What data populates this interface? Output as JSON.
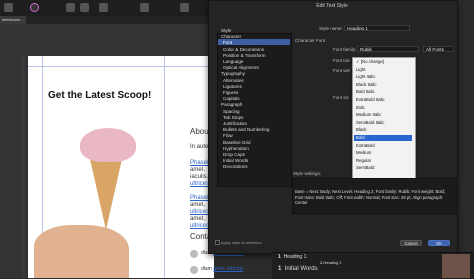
{
  "toolbar": {
    "tab_label": "eferences..."
  },
  "document": {
    "headline": "Get the Latest Scoop!",
    "about_label": "Abou",
    "body_lines": [
      "In aute",
      "Phasell",
      "amet,",
      "iaculis.",
      "ultrices,",
      "Phasell",
      "amet,",
      "ultrices,",
      "amet,",
      "ultrices,"
    ],
    "contacts_label": "Conta",
    "meta_1_prefix": "diam",
    "meta_1_link": "amet, lobortis",
    "meta_2_prefix": "diam",
    "meta_2_link": "amet, lobortis"
  },
  "dialog": {
    "title": "Edit Text Style",
    "style_label": "Style",
    "style_name_label": "Style name:",
    "style_name_value": "Heading 1",
    "character_font_label": "Character Font",
    "font_family_label": "Font family:",
    "font_family_value": "Rubik",
    "font_filter_value": "All Fonts",
    "font_traits_label": "Font trai",
    "font_weight_label": "Font wei",
    "font_size_label": "Font siz",
    "tree": [
      {
        "label": "Style",
        "level": 0
      },
      {
        "label": "Character",
        "level": 0
      },
      {
        "label": "Font",
        "level": 1,
        "selected": true
      },
      {
        "label": "Color & Decorations",
        "level": 1
      },
      {
        "label": "Position & Transform",
        "level": 1
      },
      {
        "label": "Language",
        "level": 1
      },
      {
        "label": "Optical Alignment",
        "level": 1
      },
      {
        "label": "Typography",
        "level": 0
      },
      {
        "label": "Alternates",
        "level": 1
      },
      {
        "label": "Ligatures",
        "level": 1
      },
      {
        "label": "Figures",
        "level": 1
      },
      {
        "label": "Capitals",
        "level": 1
      },
      {
        "label": "Paragraph",
        "level": 0
      },
      {
        "label": "Spacing",
        "level": 1
      },
      {
        "label": "Tab Stops",
        "level": 1
      },
      {
        "label": "Justification",
        "level": 1
      },
      {
        "label": "Bullets and Numbering",
        "level": 1
      },
      {
        "label": "Flow",
        "level": 1
      },
      {
        "label": "Baseline Grid",
        "level": 1
      },
      {
        "label": "Hyphenation",
        "level": 1
      },
      {
        "label": "Drop Caps",
        "level": 1
      },
      {
        "label": "Initial Words",
        "level": 1
      },
      {
        "label": "Decorations",
        "level": 1
      }
    ],
    "dropdown_items": [
      "✓ [No change]",
      "Light",
      "Light Italic",
      "Black Italic",
      "Bold Italic",
      "ExtraBold Italic",
      "Italic",
      "Medium Italic",
      "SemiBold Italic",
      "Black",
      "Bold",
      "ExtraBold",
      "Medium",
      "Regular",
      "SemiBold"
    ],
    "dropdown_selected_index": 10,
    "style_settings_label": "Style settings:",
    "style_settings_text": "Base = Next: Body; Next Level: Heading 2; Font family: Rubik; Font weight: Bold; Font traits: Bold Italic; Off; Font width: Normal; Font size: 28 pt; Align paragraph: Center",
    "apply_checkbox_label": "Apply style to selection",
    "cancel_label": "Cancel",
    "ok_label": "OK"
  },
  "bottom_panel": {
    "item_1_number": "1",
    "item_1_label": "Heading 1",
    "item_2_number": "1",
    "item_2_label": "Heading 2",
    "item_3_number": "1",
    "item_3_label": "Initial Words"
  },
  "colors": {
    "accent": "#2a64d0",
    "selection_blue": "#3f5fa3",
    "link": "#2b63c6",
    "dialog_bg": "#242424"
  }
}
